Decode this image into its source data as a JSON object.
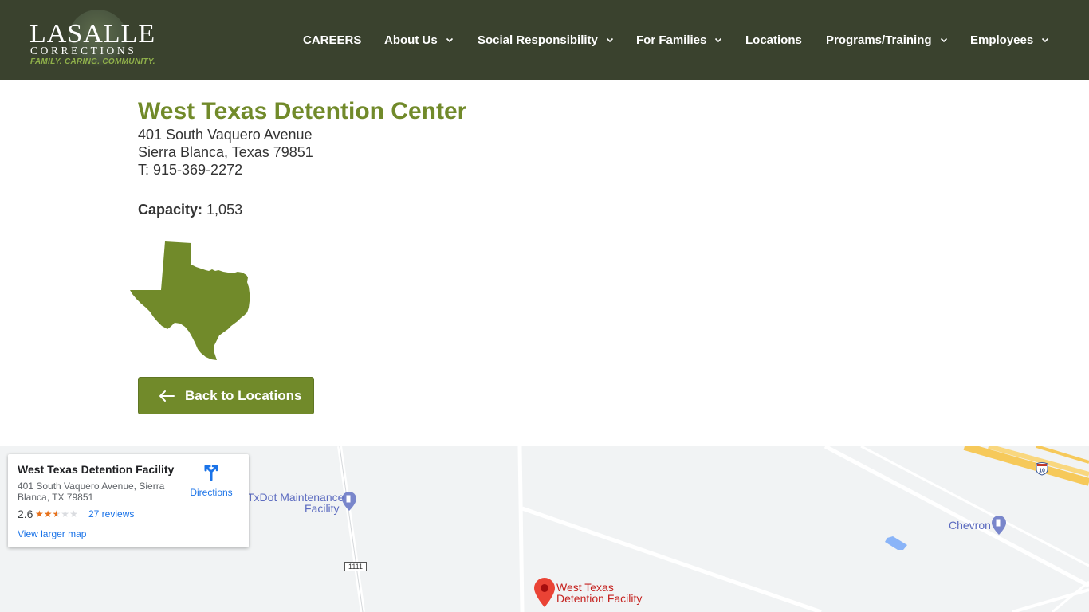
{
  "brand": {
    "logo_main": "LaSalle",
    "logo_sub": "CORRECTIONS",
    "logo_tagline": "FAMILY. CARING. COMMUNITY."
  },
  "nav": {
    "items": [
      {
        "label": "CAREERS",
        "dropdown": false
      },
      {
        "label": "About Us",
        "dropdown": true
      },
      {
        "label": "Social Responsibility",
        "dropdown": true
      },
      {
        "label": "For Families",
        "dropdown": true
      },
      {
        "label": "Locations",
        "dropdown": false
      },
      {
        "label": "Programs/Training",
        "dropdown": true
      },
      {
        "label": "Employees",
        "dropdown": true
      }
    ]
  },
  "facility": {
    "title": "West Texas Detention Center",
    "address_line1": "401 South Vaquero Avenue",
    "address_line2": "Sierra Blanca, Texas 79851",
    "phone": "T: 915-369-2272",
    "capacity_label": "Capacity:",
    "capacity_value": "1,053",
    "state_icon": "texas-state-shape"
  },
  "back_button": {
    "label": "Back to Locations",
    "icon": "arrow-left-icon"
  },
  "map": {
    "card": {
      "title": "West Texas Detention Facility",
      "address": "401 South Vaquero Avenue, Sierra Blanca, TX 79851",
      "rating": "2.6",
      "rating_value": 2.6,
      "reviews": "27 reviews",
      "directions": "Directions",
      "view_larger": "View larger map"
    },
    "labels": {
      "txdot": "TxDot Maintenance",
      "txdot2": "Facility",
      "chevron": "Chevron",
      "pin_line1": "West Texas",
      "pin_line2": "Detention Facility",
      "route": "1111",
      "interstate": "10"
    }
  },
  "colors": {
    "header_bg": "#3a422e",
    "accent_green": "#718a2a",
    "map_pin": "#ea4335",
    "link_blue": "#1a73e8"
  }
}
